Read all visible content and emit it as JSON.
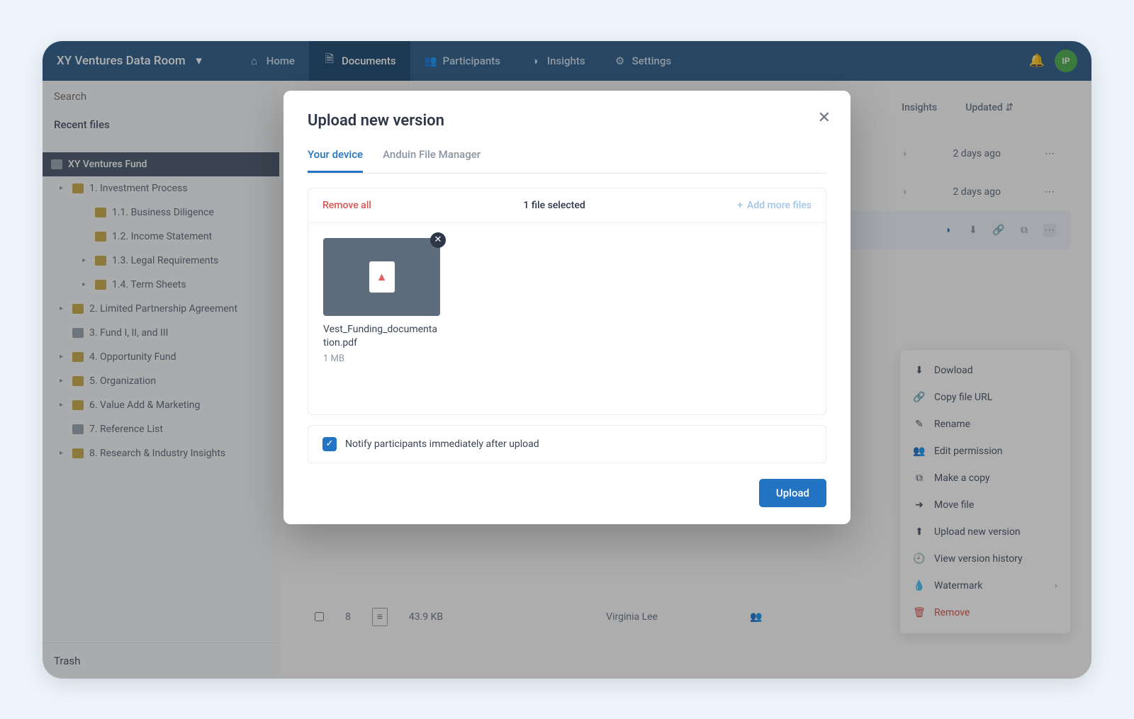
{
  "header": {
    "room_name": "XY Ventures Data Room",
    "nav": [
      {
        "label": "Home",
        "icon": "home"
      },
      {
        "label": "Documents",
        "icon": "document",
        "active": true
      },
      {
        "label": "Participants",
        "icon": "people"
      },
      {
        "label": "Insights",
        "icon": "chart"
      },
      {
        "label": "Settings",
        "icon": "gear"
      }
    ],
    "avatar_initials": "IP"
  },
  "sidebar": {
    "search_placeholder": "Search",
    "recent_label": "Recent files",
    "trash_label": "Trash",
    "tree": {
      "root": "XY Ventures Fund",
      "items": [
        {
          "label": "1. Investment Process",
          "caret": true,
          "depth": 1
        },
        {
          "label": "1.1. Business Diligence",
          "depth": 2
        },
        {
          "label": "1.2. Income Statement",
          "depth": 2
        },
        {
          "label": "1.3. Legal Requirements",
          "caret": true,
          "depth": 2
        },
        {
          "label": "1.4. Term Sheets",
          "caret": true,
          "depth": 2
        },
        {
          "label": "2. Limited Partnership Agreement",
          "caret": true,
          "depth": 1
        },
        {
          "label": "3. Fund I, II, and III",
          "depth": 1,
          "gray": true
        },
        {
          "label": "4. Opportunity Fund",
          "caret": true,
          "depth": 1
        },
        {
          "label": "5. Organization",
          "caret": true,
          "depth": 1
        },
        {
          "label": "6. Value Add & Marketing",
          "caret": true,
          "depth": 1
        },
        {
          "label": "7. Reference List",
          "depth": 1,
          "gray": true
        },
        {
          "label": "8. Research & Industry Insights",
          "caret": true,
          "depth": 1
        }
      ]
    }
  },
  "main": {
    "columns": {
      "insights": "Insights",
      "updated": "Updated"
    },
    "rows": [
      {
        "updated": "2 days ago"
      },
      {
        "updated": "2 days ago"
      }
    ],
    "bottom_row": {
      "index": "8",
      "size": "43.9 KB",
      "owner": "Virginia Lee"
    }
  },
  "context_menu": {
    "items": [
      {
        "label": "Dowload",
        "icon": "download"
      },
      {
        "label": "Copy file URL",
        "icon": "link"
      },
      {
        "label": "Rename",
        "icon": "pencil"
      },
      {
        "label": "Edit permission",
        "icon": "people"
      },
      {
        "label": "Make a copy",
        "icon": "copy"
      },
      {
        "label": "Move file",
        "icon": "move"
      },
      {
        "label": "Upload new version",
        "icon": "upload"
      },
      {
        "label": "View version history",
        "icon": "clock"
      },
      {
        "label": "Watermark",
        "icon": "drop",
        "arrow": true
      },
      {
        "label": "Remove",
        "icon": "trash",
        "danger": true
      }
    ]
  },
  "modal": {
    "title": "Upload new version",
    "tabs": [
      {
        "label": "Your device",
        "active": true
      },
      {
        "label": "Anduin File Manager"
      }
    ],
    "remove_all": "Remove all",
    "selected_text": "1 file selected",
    "add_more": "Add more files",
    "file": {
      "name": "Vest_Funding_documentation.pdf",
      "size": "1 MB"
    },
    "notify_label": "Notify participants immediately after upload",
    "upload_button": "Upload"
  }
}
